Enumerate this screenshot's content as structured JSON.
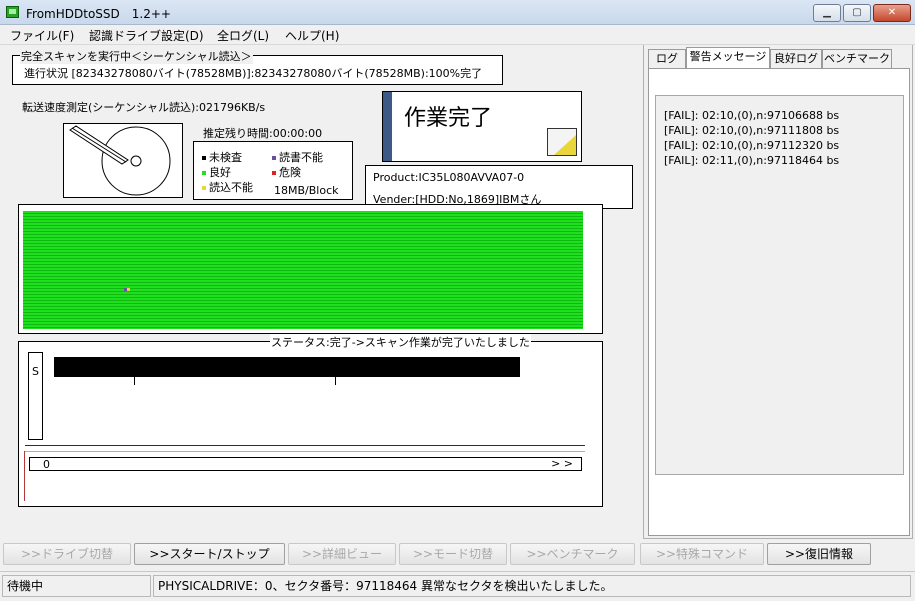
{
  "window": {
    "title": "FromHDDtoSSD　1.2++",
    "min_glyph": "▁",
    "max_glyph": "▢",
    "close_glyph": "✕"
  },
  "menu": [
    "ファイル(F)",
    "認識ドライブ設定(D)",
    "全ログ(L)",
    "ヘルプ(H)"
  ],
  "scan": {
    "title": "完全スキャンを実行中＜シーケンシャル読込＞",
    "progress": "進行状況 [82343278080バイト(78528MB)]:82343278080バイト(78528MB):100%完了"
  },
  "speed": "転送速度測定(シーケンシャル読込):021796KB/s",
  "remaining": "推定残り時間:00:00:00",
  "legend": {
    "unchecked": "未検査",
    "unreadable_rw": "読書不能",
    "good": "良好",
    "danger": "危険",
    "read_fail": "読込不能",
    "block": "18MB/Block",
    "colors": {
      "unchecked": "#000000",
      "unreadable_rw": "#6a4fa0",
      "good": "#1ee01e",
      "danger": "#e02020",
      "read_fail": "#e8d63a"
    }
  },
  "done": {
    "text": "作業完了"
  },
  "product": {
    "product": "Product:IC35L080AVVA07-0",
    "vender": "Vender:[HDD:No,1869]IBMさん"
  },
  "status": {
    "title": "ステータス:完了->スキャン作業が完了いたしました",
    "s_label": "S",
    "progress_zero": "0",
    "progress_arrow": "> >"
  },
  "tabs": [
    "ログ",
    "警告メッセージ",
    "良好ログ",
    "ベンチマーク"
  ],
  "active_tab": "警告メッセージ",
  "warnings": [
    "[FAIL]: 02:10,(0),n:97106688 bs",
    "[FAIL]: 02:10,(0),n:97111808 bs",
    "[FAIL]: 02:10,(0),n:97112320 bs",
    "[FAIL]: 02:11,(0),n:97118464 bs"
  ],
  "buttons": [
    {
      "label": ">>ドライブ切替",
      "enabled": false
    },
    {
      "label": ">>スタート/ストップ",
      "enabled": true
    },
    {
      "label": ">>詳細ビュー",
      "enabled": false
    },
    {
      "label": ">>モード切替",
      "enabled": false
    },
    {
      "label": ">>ベンチマーク",
      "enabled": false
    },
    {
      "label": ">>特殊コマンド",
      "enabled": false
    },
    {
      "label": ">>復旧情報",
      "enabled": true
    }
  ],
  "statusbar": {
    "left": "待機中",
    "right": "PHYSICALDRIVE：0、セクタ番号：97118464 異常なセクタを検出いたしました。"
  }
}
